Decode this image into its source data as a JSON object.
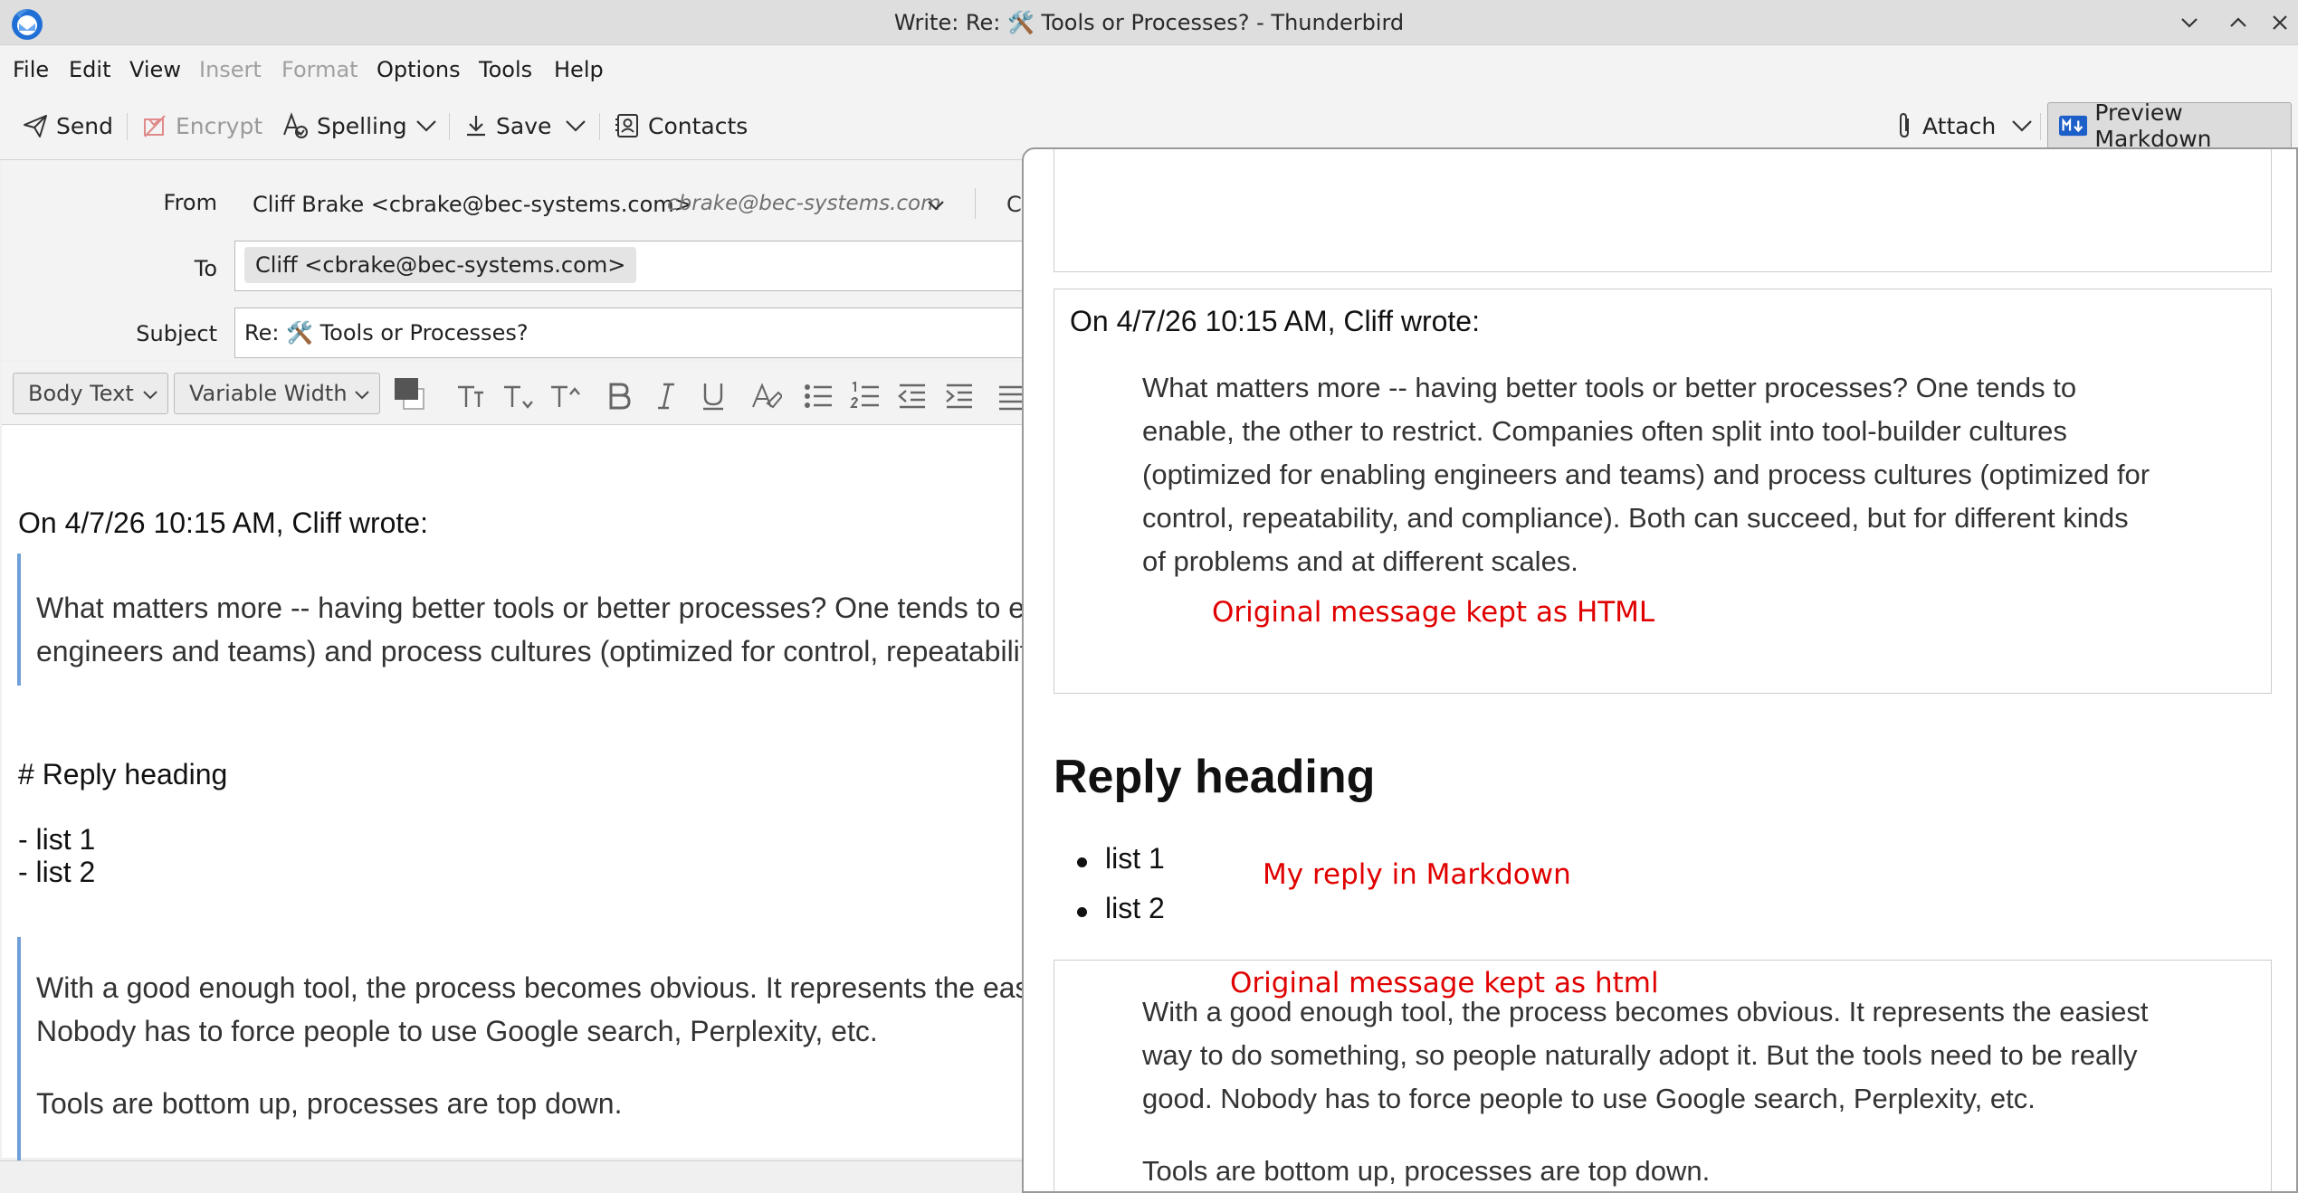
{
  "window": {
    "title": "Write: Re: 🛠️ Tools or Processes? - Thunderbird"
  },
  "menu": {
    "file": "File",
    "edit": "Edit",
    "view": "View",
    "insert": "Insert",
    "format": "Format",
    "options": "Options",
    "tools": "Tools",
    "help": "Help"
  },
  "toolbar": {
    "send": "Send",
    "encrypt": "Encrypt",
    "spelling": "Spelling",
    "save": "Save",
    "contacts": "Contacts",
    "attach": "Attach",
    "preview_markdown": "Preview Markdown"
  },
  "header": {
    "from_label": "From",
    "from_value": "Cliff Brake <cbrake@bec-systems.com>",
    "from_identity": "cbrake@bec-systems.com",
    "to_label": "To",
    "to_recipient": "Cliff <cbrake@bec-systems.com>",
    "subject_label": "Subject",
    "subject_value": "Re: 🛠️ Tools or Processes?"
  },
  "format_bar": {
    "paragraph_style": "Body Text",
    "font": "Variable Width"
  },
  "body": {
    "cite": "On 4/7/26 10:15 AM, Cliff wrote:",
    "quote1_line1": "What matters more -- having better tools or better processes? One tends to e",
    "quote1_line2": "engineers and teams) and process cultures (optimized for control, repeatabilit",
    "heading": "# Reply heading",
    "list1": "- list 1",
    "list2": "- list 2",
    "quote2_line1": "With a good enough tool, the process becomes obvious. It represents the eas",
    "quote2_line2": "Nobody has to force people to use Google search, Perplexity, etc.",
    "quote2_line3": "Tools are bottom up, processes are top down."
  },
  "preview": {
    "cite": "On 4/7/26 10:15 AM, Cliff wrote:",
    "quote1": [
      "What matters more -- having better tools or better processes? One tends to",
      "enable, the other to restrict. Companies often split into tool-builder cultures",
      "(optimized for enabling engineers and teams) and process cultures (optimized for",
      "control, repeatability, and compliance). Both can succeed, but for different kinds",
      "of problems and at different scales."
    ],
    "note_html": "Original message kept as HTML",
    "heading": "Reply heading",
    "list": [
      "list 1",
      "list 2"
    ],
    "note_markdown": "My reply in Markdown",
    "note_html2": "Original message kept as html",
    "quote2": [
      "With a good enough tool, the process becomes obvious. It represents the easiest",
      "way to do something, so people naturally adopt it. But the tools need to be really",
      "good. Nobody has to force people to use Google search, Perplexity, etc."
    ],
    "quote2_last": "Tools are bottom up, processes are top down."
  },
  "colors": {
    "annotation": "#e00000",
    "quote_bar": "#6f9fd8",
    "brand": "#1f6fd6"
  }
}
